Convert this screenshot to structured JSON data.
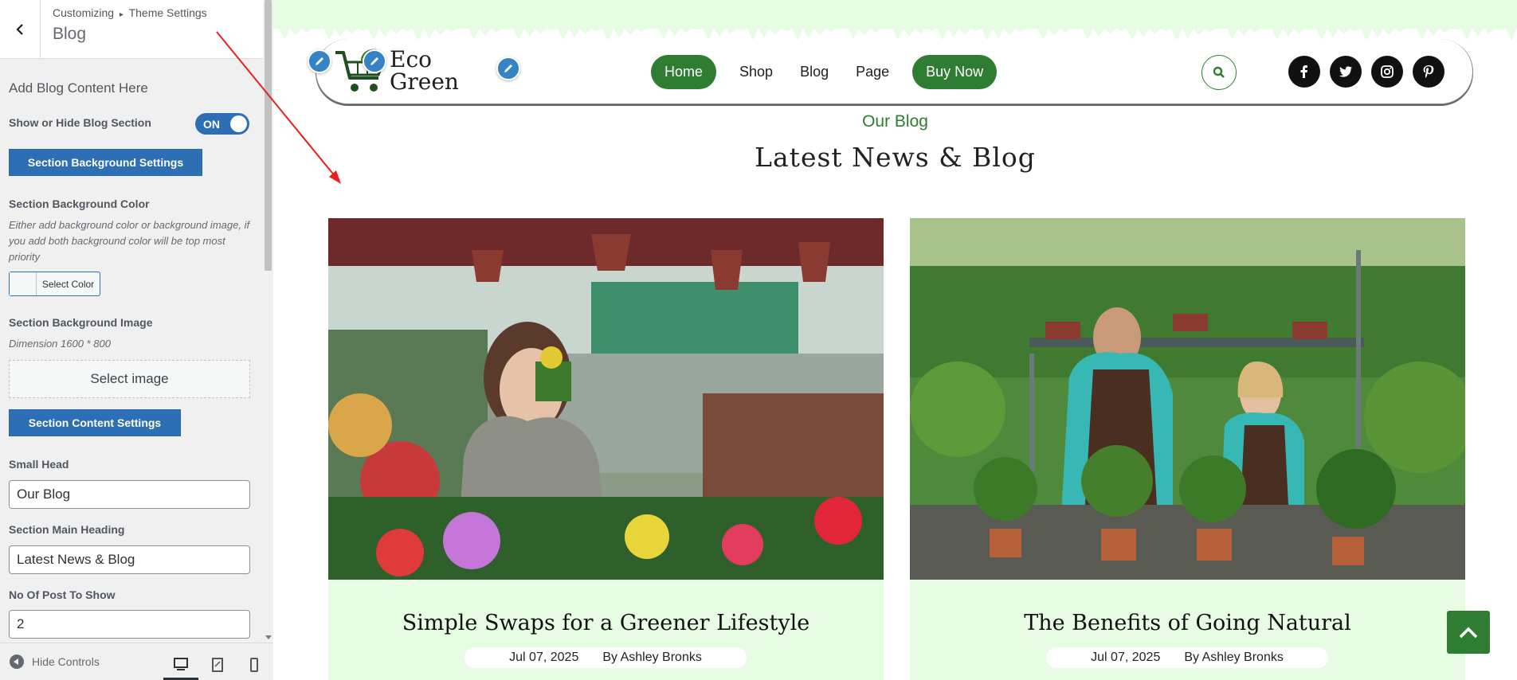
{
  "customizer": {
    "breadcrumb_parent": "Customizing",
    "breadcrumb_separator": "▸",
    "breadcrumb_section": "Theme Settings",
    "panel_title": "Blog",
    "section_title": "Add Blog Content Here",
    "show_hide_label": "Show or Hide Blog Section",
    "toggle_state": "ON",
    "bg_settings_button": "Section Background Settings",
    "bg_color_label": "Section Background Color",
    "bg_color_desc": "Either add background color or background image, if you add both background color will be top most priority",
    "select_color_label": "Select Color",
    "bg_image_label": "Section Background Image",
    "bg_image_dimension": "Dimension 1600 * 800",
    "select_image_label": "Select image",
    "content_settings_button": "Section Content Settings",
    "small_head_label": "Small Head",
    "small_head_value": "Our Blog",
    "main_heading_label": "Section Main Heading",
    "main_heading_value": "Latest News & Blog",
    "post_count_label": "No Of Post To Show",
    "post_count_value": "2",
    "hide_controls_label": "Hide Controls",
    "devices": [
      "desktop-icon",
      "tablet-icon",
      "mobile-icon"
    ],
    "accent_color": "#2c6fb4"
  },
  "site": {
    "logo_line1": "Eco",
    "logo_line2": "Green",
    "nav": [
      "Home",
      "Shop",
      "Blog",
      "Page"
    ],
    "buy_now": "Buy Now",
    "socials": [
      "facebook-icon",
      "twitter-icon",
      "instagram-icon",
      "pinterest-icon"
    ],
    "small_head": "Our Blog",
    "main_heading": "Latest News & Blog",
    "brand_color": "#2e7d32",
    "card_bg_color": "#e6fde4",
    "posts": [
      {
        "title": "Simple Swaps for a Greener Lifestyle",
        "date": "Jul 07, 2025",
        "author": "By Ashley Bronks"
      },
      {
        "title": "The Benefits of Going Natural",
        "date": "Jul 07, 2025",
        "author": "By Ashley Bronks"
      }
    ]
  }
}
